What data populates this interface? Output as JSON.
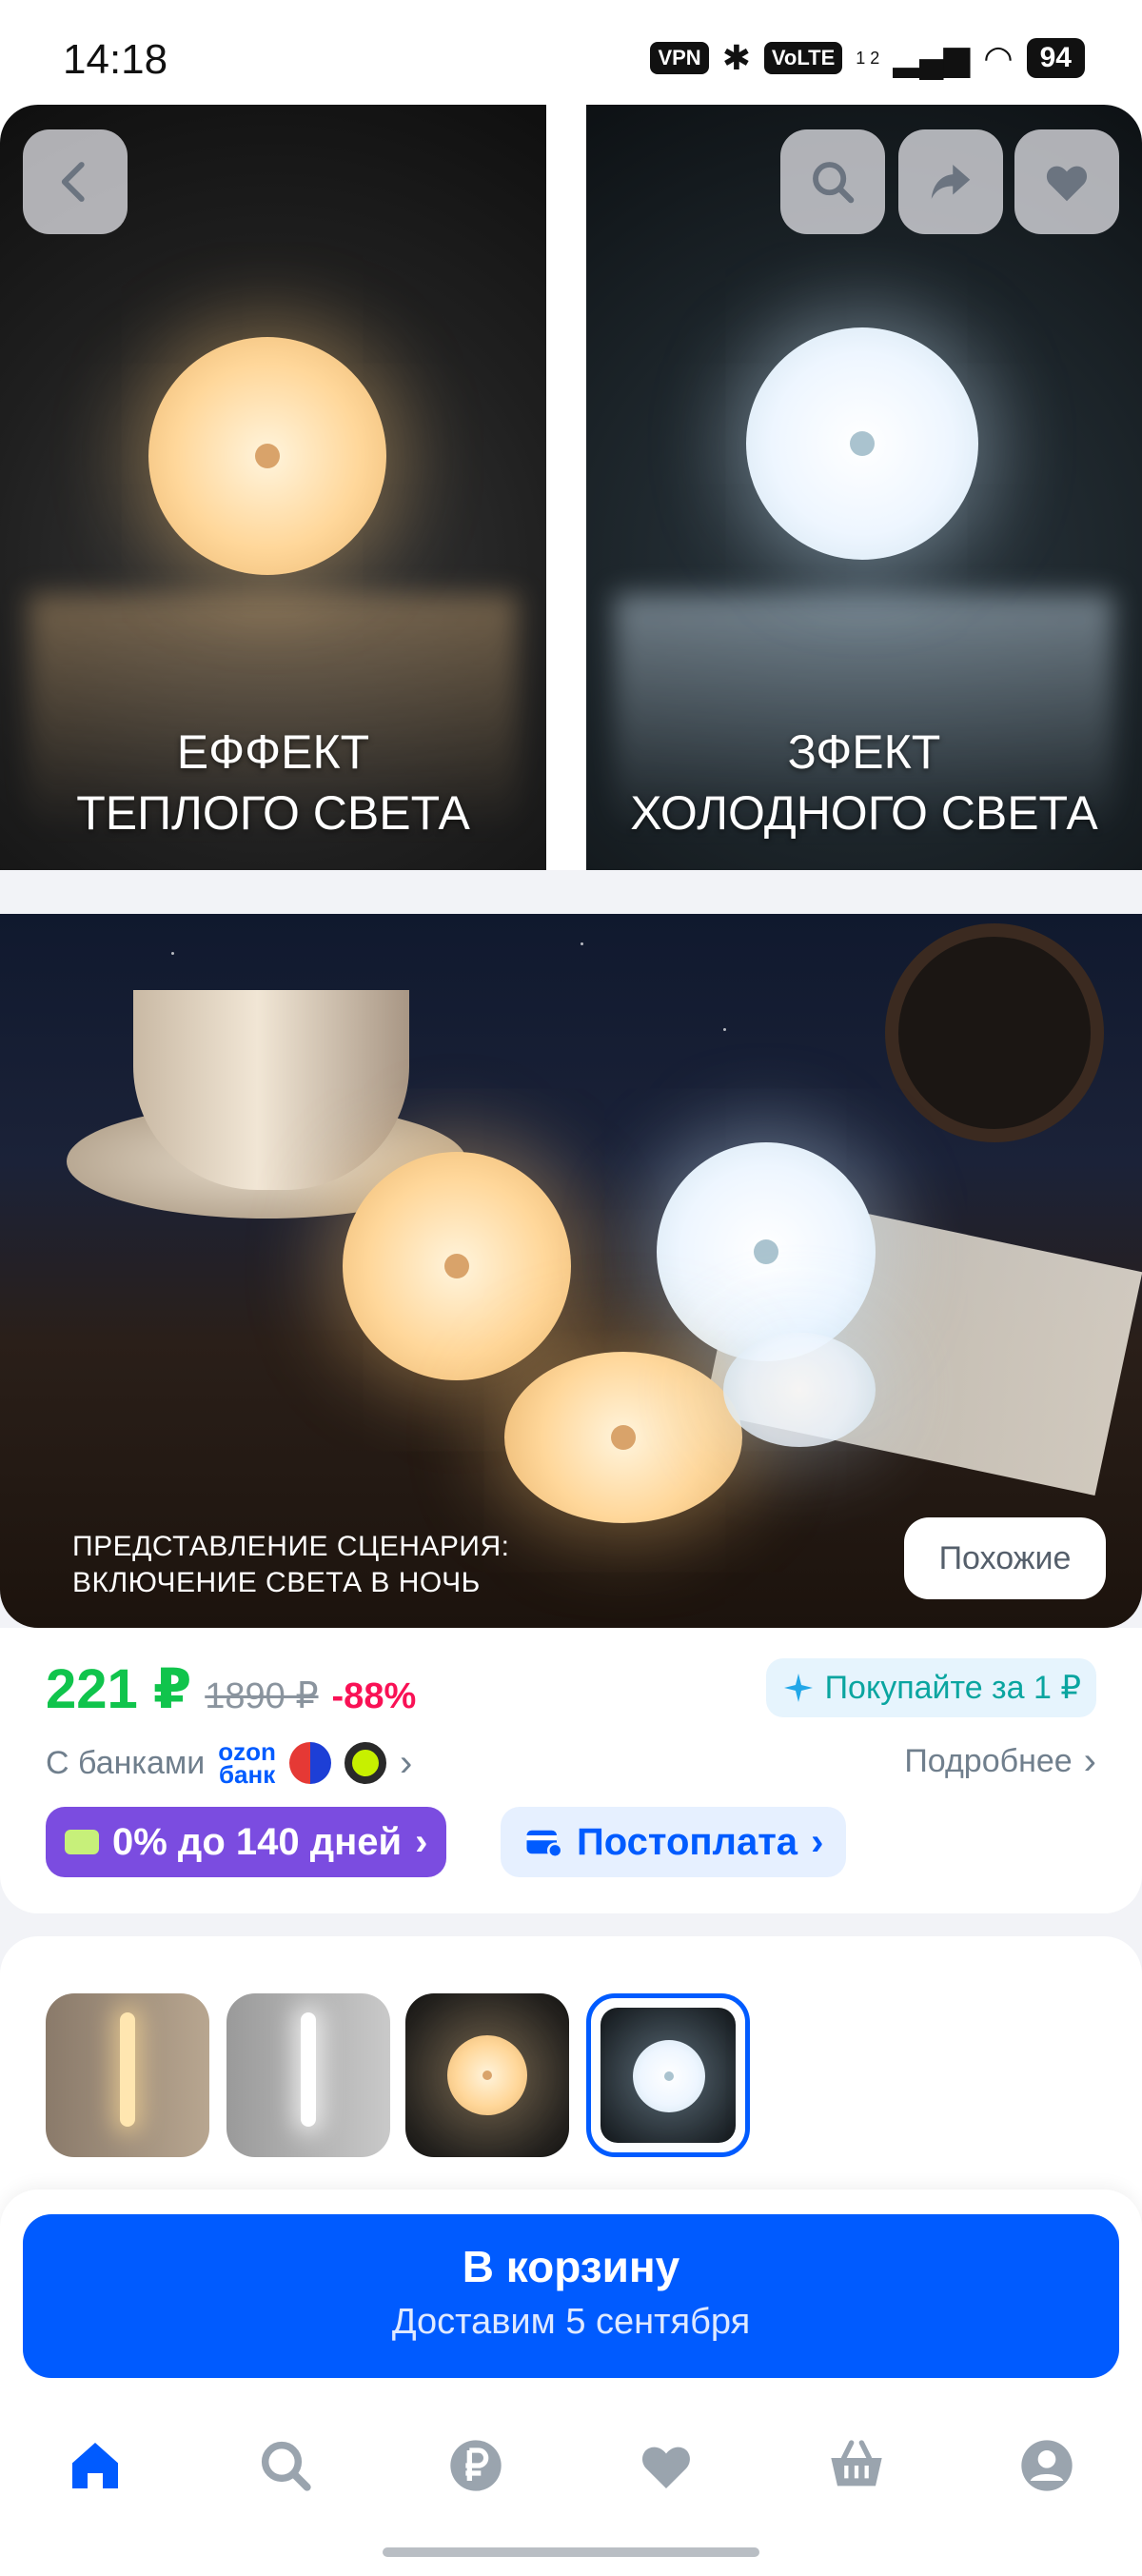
{
  "status_bar": {
    "time": "14:18",
    "vpn": "VPN",
    "volte": "VoLTE",
    "sim": "1 2",
    "battery": "94"
  },
  "gallery": {
    "photo_left_caption_line1": "ЕФФЕКТ",
    "photo_left_caption_line2": "ТЕПЛОГО СВЕТА",
    "photo_right_caption_line1": "ЗФЕКТ",
    "photo_right_caption_line2": "ХОЛОДНОГО СВЕТА",
    "photo2_caption_line1": "ПРЕДСТАВЛЕНИЕ СЦЕНАРИЯ:",
    "photo2_caption_line2": "ВКЛЮЧЕНИЕ СВЕТА В НОЧЬ",
    "similar_button": "Похожие",
    "icons": [
      "back-icon",
      "search-icon",
      "share-icon",
      "favorite-icon"
    ]
  },
  "price": {
    "current": "221 ₽",
    "old": "1890 ₽",
    "discount": "-88%",
    "buy_for_one": "Покупайте за 1 ₽",
    "with_banks": "С банками",
    "ozon_bank_line1": "ozon",
    "ozon_bank_line2": "банк",
    "more": "Подробнее",
    "installment": "0% до 140 дней",
    "postpay": "Постоплата",
    "colors": {
      "price": "#10c44c",
      "discount": "#f91155",
      "installment": "#7b4ce0",
      "accent": "#005bff"
    }
  },
  "variants": {
    "items": [
      "warm-bar",
      "cold-bar",
      "warm-disc",
      "cold-disc"
    ],
    "selected_index": 3
  },
  "cta": {
    "title": "В корзину",
    "subtitle": "Доставим 5 сентября"
  },
  "tabbar": [
    "home-icon",
    "search-icon",
    "ruble-icon",
    "favorites-icon",
    "cart-icon",
    "profile-icon"
  ]
}
